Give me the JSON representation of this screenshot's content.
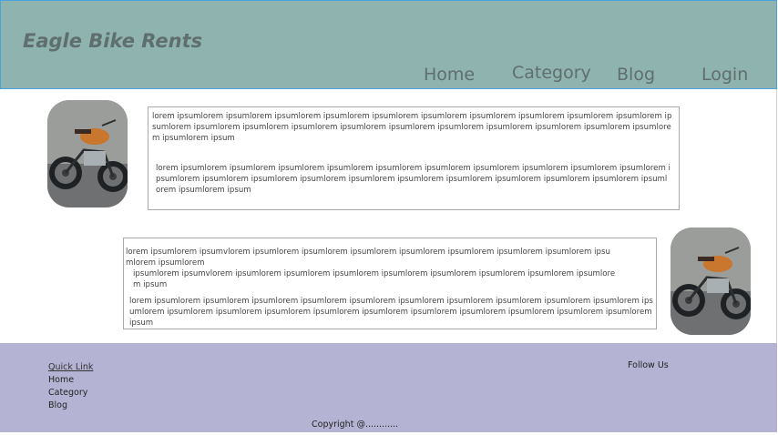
{
  "header": {
    "brand": "Eagle Bike Rents",
    "nav": {
      "home": "Home",
      "category": "Category",
      "blog": "Blog",
      "login": "Login"
    }
  },
  "main": {
    "section1": {
      "image_icon": "motorcycle-photo",
      "para1": "lorem ipsumlorem ipsumlorem ipsumlorem ipsumlorem ipsumlorem ipsumlorem ipsumlorem ipsumlorem ipsumlorem ipsumlorem ipsumlorem ipsumlorem ipsumlorem ipsumlorem ipsumlorem ipsumlorem ipsumlorem ipsumlorem ipsumlorem ipsumlorem ipsumlorem ipsumlorem ipsum",
      "para2": "lorem ipsumlorem ipsumlorem ipsumlorem ipsumlorem ipsumlorem ipsumlorem ipsumlorem ipsumlorem ipsumlorem ipsumlorem ipsumlorem ipsumlorem ipsumlorem ipsumlorem ipsumlorem ipsumlorem ipsumlorem ipsumlorem ipsumlorem ipsumlorem ipsumlorem ipsumlorem ipsum"
    },
    "section2": {
      "image_icon": "motorcycle-photo",
      "para1_line1": "lorem ipsumlorem ipsumvlorem ipsumlorem ipsumlorem ipsumlorem ipsumlorem ipsumlorem ipsumlorem ipsumlorem ipsumlorem ipsumlorem",
      "para1_line2": "ipsumlorem ipsumvlorem ipsumlorem ipsumlorem ipsumlorem ipsumlorem ipsumlorem ipsumlorem ipsumlorem ipsumlorem ipsum",
      "para2": "lorem ipsumlorem ipsumlorem ipsumlorem ipsumlorem ipsumlorem ipsumlorem ipsumlorem ipsumlorem ipsumlorem ipsumlorem ipsumlorem ipsumlorem ipsumlorem ipsumlorem ipsumlorem ipsumlorem ipsumlorem ipsumlorem ipsumlorem ipsumlorem ipsumlorem ipsum"
    }
  },
  "footer": {
    "quick_link_title": "Quick Link",
    "links": {
      "home": "Home",
      "category": "Category",
      "blog": "Blog"
    },
    "follow_us": "Follow Us",
    "copyright": "Copyright @............"
  },
  "colors": {
    "header_bg": "#8fb3ae",
    "header_border": "#4aa3df",
    "footer_bg": "#b4b3d4",
    "nav_text": "#5f6e6e"
  }
}
